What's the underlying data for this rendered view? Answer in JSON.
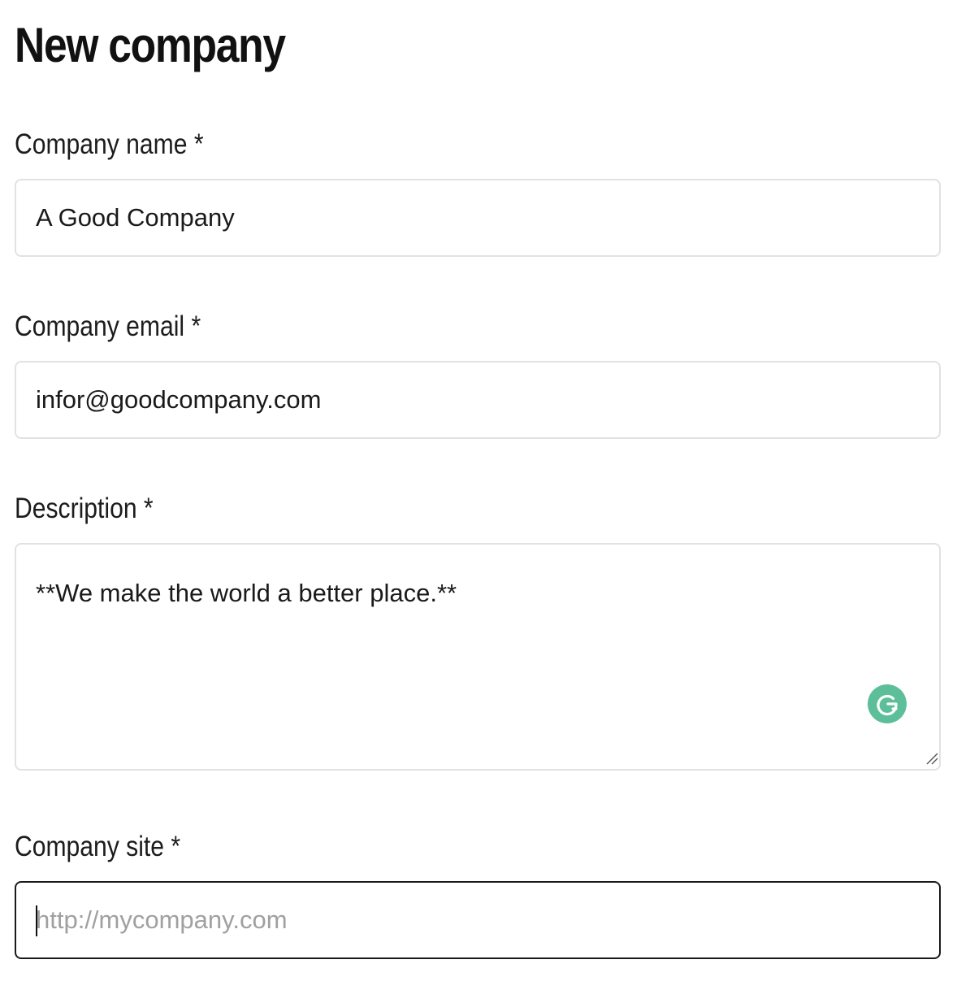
{
  "title": "New company",
  "fields": {
    "company_name": {
      "label": "Company name *",
      "value": "A Good Company"
    },
    "company_email": {
      "label": "Company email *",
      "value": "infor@goodcompany.com"
    },
    "description": {
      "label": "Description *",
      "value": "**We make the world a better place.**"
    },
    "company_site": {
      "label": "Company site *",
      "value": "",
      "placeholder": "http://mycompany.com"
    }
  },
  "icons": {
    "grammarly": "grammarly-icon",
    "resize": "resize-handle-icon"
  },
  "colors": {
    "text": "#1a1a1a",
    "input_border": "#e2e2e2",
    "focused_border": "#1a1a1a",
    "placeholder": "#a0a0a0",
    "grammarly_green": "#5cbf9a"
  }
}
